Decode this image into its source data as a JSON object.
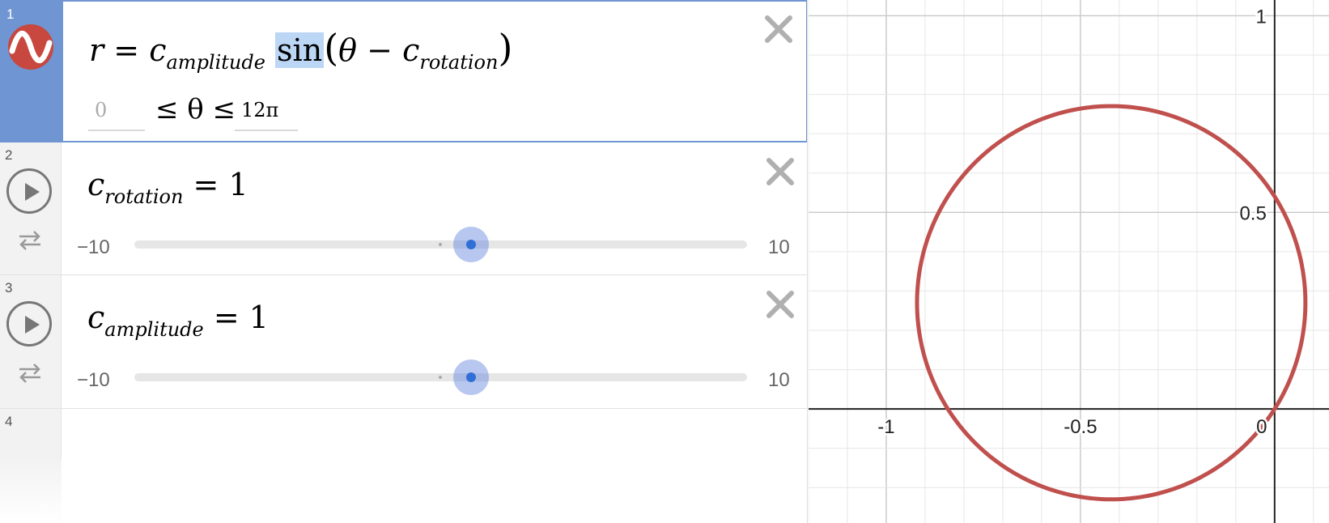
{
  "expressions": [
    {
      "index": "1",
      "icon": "polar-curve-icon",
      "latex": {
        "r": "r",
        "eq": "=",
        "c": "c",
        "amp_sub": "amplitude",
        "sin": "sin",
        "theta": "θ",
        "minus": "−",
        "c2": "c",
        "rot_sub": "rotation"
      },
      "domain": {
        "min_placeholder": "0",
        "inequality": "≤ θ ≤",
        "max_value": "12π"
      }
    },
    {
      "index": "2",
      "variable": "c",
      "subscript": "rotation",
      "eq": "=",
      "value": "1",
      "slider": {
        "min": "−10",
        "max": "10",
        "current": 1,
        "min_num": -10,
        "max_num": 10
      }
    },
    {
      "index": "3",
      "variable": "c",
      "subscript": "amplitude",
      "eq": "=",
      "value": "1",
      "slider": {
        "min": "−10",
        "max": "10",
        "current": 1,
        "min_num": -10,
        "max_num": 10
      }
    },
    {
      "index": "4"
    }
  ],
  "graph": {
    "x_ticks": [
      "-1",
      "-0.5",
      "0"
    ],
    "y_ticks": [
      "1",
      "0.5"
    ],
    "curve_color": "#c0504d",
    "x_range": [
      -1.2,
      0.14
    ],
    "y_range": [
      -0.29,
      1.04
    ]
  }
}
